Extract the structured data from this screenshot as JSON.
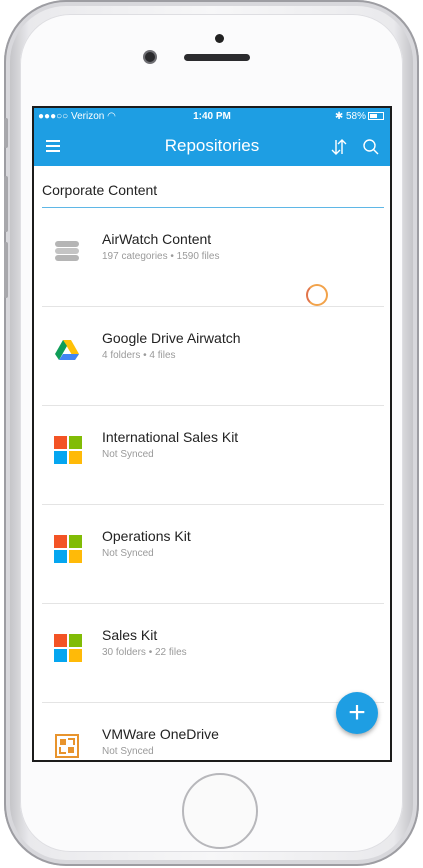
{
  "status_bar": {
    "carrier": "Verizon",
    "time": "1:40 PM",
    "battery": "58%"
  },
  "app_bar": {
    "title": "Repositories",
    "icons": [
      "menu-icon",
      "sort-icon",
      "search-icon"
    ]
  },
  "section": {
    "title": "Corporate Content"
  },
  "repositories": [
    {
      "name": "AirWatch Content",
      "meta": "197 categories • 1590 files",
      "icon": "database-icon"
    },
    {
      "name": "Google Drive Airwatch",
      "meta": "4 folders • 4 files",
      "icon": "google-drive-icon"
    },
    {
      "name": "International Sales Kit",
      "meta": "Not Synced",
      "icon": "sharepoint-icon"
    },
    {
      "name": "Operations Kit",
      "meta": "Not Synced",
      "icon": "sharepoint-icon"
    },
    {
      "name": "Sales Kit",
      "meta": "30 folders • 22 files",
      "icon": "sharepoint-icon"
    },
    {
      "name": "VMWare OneDrive",
      "meta": "Not Synced",
      "icon": "onedrive-icon"
    }
  ],
  "fab": {
    "icon": "plus-icon"
  },
  "colors": {
    "accent": "#1e9ee3",
    "ms_red": "#f35325",
    "ms_green": "#81bc06",
    "ms_blue": "#05a6f0",
    "ms_yellow": "#ffba08",
    "onedrive_orange": "#e8942d"
  }
}
